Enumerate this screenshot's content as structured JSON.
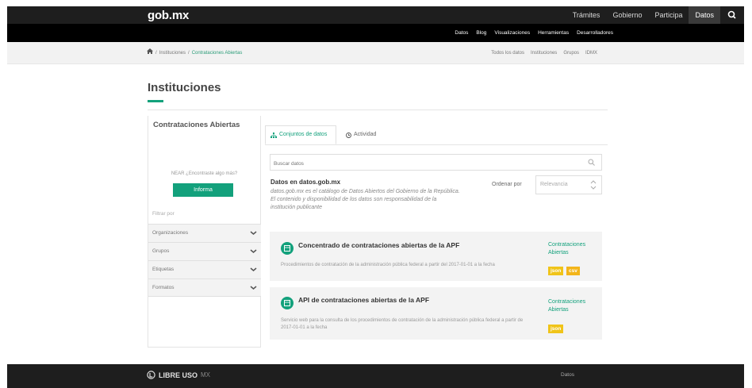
{
  "header": {
    "logo": "gob.mx",
    "nav": [
      "Trámites",
      "Gobierno",
      "Participa",
      "Datos"
    ],
    "active_nav": "Datos"
  },
  "subnav": [
    "Datos",
    "Blog",
    "Visualizaciones",
    "Herramientas",
    "Desarrolladores"
  ],
  "breadcrumb": {
    "items": [
      "Instituciones",
      "Contrataciones Abiertas"
    ]
  },
  "breadlinks": [
    "Todos los datos",
    "Instituciones",
    "Grupos",
    "IDMX"
  ],
  "page": {
    "title": "Instituciones"
  },
  "sidebar": {
    "org_title": "Contrataciones Abiertas",
    "help_text": "NEAR ¿Encontraste algo más?",
    "inform_button": "Informa",
    "filter_label": "Filtrar por",
    "filters": [
      "Organizaciones",
      "Grupos",
      "Etiquetas",
      "Formatos"
    ]
  },
  "tabs": {
    "datasets": "Conjuntos de datos",
    "activity": "Actividad"
  },
  "search": {
    "placeholder": "Buscar datos"
  },
  "intro": {
    "title": "Datos en datos.gob.mx",
    "description": "datos.gob.mx es el catálogo de Datos Abiertos del Gobierno de la República. El contenido y disponibilidad de los datos son responsabilidad de la institución publicante"
  },
  "order": {
    "label": "Ordenar por",
    "value": "Relevancia"
  },
  "datasets": [
    {
      "title": "Concentrado de contrataciones abiertas de la APF",
      "description": "Procedimientos de contratación de la administración pública federal a partir del 2017-01-01 a la fecha",
      "org": "Contrataciones Abiertas",
      "formats": [
        "json",
        "csv"
      ]
    },
    {
      "title": "API de contrataciones abiertas de la APF",
      "description": "Servicio web para la consulta de los procedimientos de contratación de la administración pública federal a partir de 2017-01-01 a la fecha",
      "org": "Contrataciones Abiertas",
      "formats": [
        "json"
      ]
    }
  ],
  "footer": {
    "brand": "LIBRE USO",
    "brand_suffix": "MX",
    "link": "Datos"
  },
  "colors": {
    "accent": "#13a17c",
    "topbar": "#1e1e1e",
    "badge": "#f0c419"
  }
}
